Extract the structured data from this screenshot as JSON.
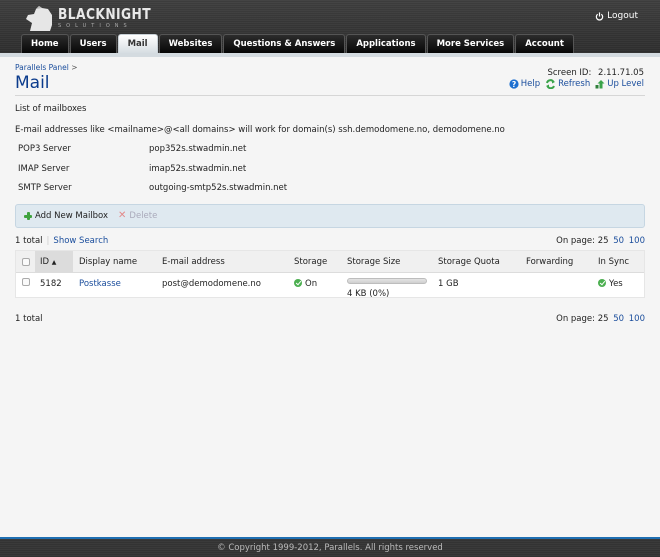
{
  "header": {
    "brand": "BLACKNIGHT",
    "brand_sub": "SOLUTIONS",
    "logout_label": "Logout",
    "tabs": [
      {
        "label": "Home",
        "active": false
      },
      {
        "label": "Users",
        "active": false
      },
      {
        "label": "Mail",
        "active": true
      },
      {
        "label": "Websites",
        "active": false
      },
      {
        "label": "Questions & Answers",
        "active": false
      },
      {
        "label": "Applications",
        "active": false
      },
      {
        "label": "More Services",
        "active": false
      },
      {
        "label": "Account",
        "active": false
      }
    ]
  },
  "breadcrumb": {
    "item": "Parallels Panel",
    "separator": ">"
  },
  "page": {
    "title": "Mail",
    "screen_id_label": "Screen ID:",
    "screen_id": "2.11.71.05",
    "actions": {
      "help": "Help",
      "refresh": "Refresh",
      "up_level": "Up Level"
    },
    "subtitle": "List of mailboxes",
    "note": "E-mail addresses like <mailname>@<all domains> will work for domain(s) ssh.demodomene.no, demodomene.no"
  },
  "servers": [
    {
      "label": "POP3 Server",
      "value": "pop352s.stwadmin.net"
    },
    {
      "label": "IMAP Server",
      "value": "imap52s.stwadmin.net"
    },
    {
      "label": "SMTP Server",
      "value": "outgoing-smtp52s.stwadmin.net"
    }
  ],
  "toolbar": {
    "add_label": "Add New Mailbox",
    "delete_label": "Delete"
  },
  "pager": {
    "total_text": "1 total",
    "show_search": "Show Search",
    "on_page_label": "On page:",
    "current": "25",
    "options": [
      "50",
      "100"
    ]
  },
  "table": {
    "columns": [
      "ID",
      "Display name",
      "E-mail address",
      "Storage",
      "Storage Size",
      "Storage Quota",
      "Forwarding",
      "In Sync"
    ],
    "sort_indicator": "▲",
    "rows": [
      {
        "id": "5182",
        "display_name": "Postkasse",
        "email": "post@demodomene.no",
        "storage": "On",
        "storage_size": "4 KB (0%)",
        "storage_used_fraction": 0,
        "storage_quota": "1 GB",
        "forwarding": "",
        "in_sync": "Yes"
      }
    ]
  },
  "footer": {
    "copyright": "© Copyright 1999-2012, Parallels. All rights reserved"
  },
  "colors": {
    "link": "#1a4d9c",
    "title": "#0b3b8c",
    "ok": "#4caf50",
    "footer_accent": "#1f6fb2"
  }
}
